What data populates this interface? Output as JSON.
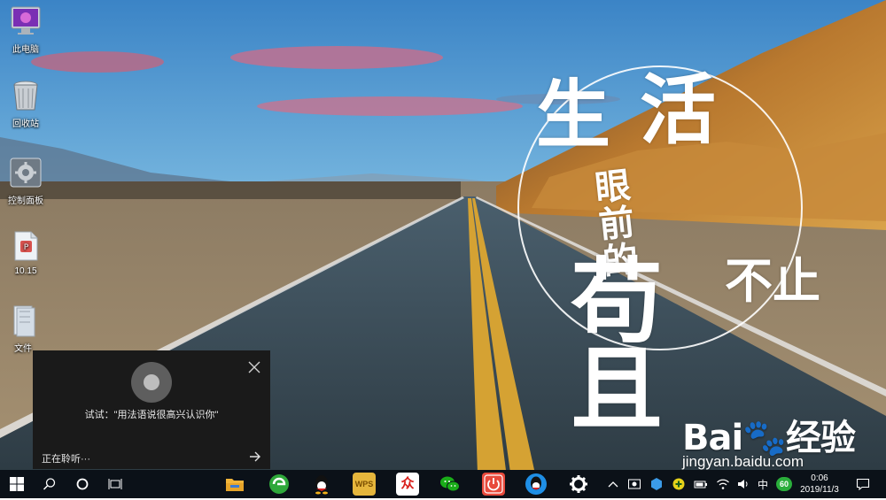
{
  "wallpaper": {
    "calligraphy": {
      "char_1": "生",
      "char_2": "活",
      "line_3": "眼前的",
      "line_4": "不止",
      "line_5": "苟且"
    },
    "watermark": {
      "logo": "Bai🐾经验",
      "url": "jingyan.baidu.com"
    }
  },
  "desktop_icons": [
    {
      "label": "此电脑",
      "icon": "this-pc-icon"
    },
    {
      "label": "回收站",
      "icon": "recycle-bin-icon"
    },
    {
      "label": "控制面板",
      "icon": "control-panel-icon"
    },
    {
      "label": "10.15",
      "icon": "document-icon"
    },
    {
      "label": "文件",
      "icon": "folder-icon"
    }
  ],
  "voice_panel": {
    "hint": "试试：\"用法语说很高兴认识你\"",
    "status": "正在聆听···"
  },
  "taskbar": {
    "pinned": [
      {
        "name": "file-explorer-icon",
        "color": "#f2b53a"
      },
      {
        "name": "browser-icon",
        "color": "#2fa83a"
      },
      {
        "name": "qq-icon",
        "color": "#111111"
      },
      {
        "name": "wps-icon",
        "color": "#e6b63c",
        "text": "WPS"
      },
      {
        "name": "app-zhong-icon",
        "color": "#ffffff",
        "text": "众"
      },
      {
        "name": "wechat-icon",
        "color": "#1aad19"
      },
      {
        "name": "power-app-icon",
        "color": "#e84a3c"
      },
      {
        "name": "qq-blue-icon",
        "color": "#1f8fe6"
      },
      {
        "name": "settings-icon",
        "color": "#ffffff"
      }
    ],
    "tray": {
      "ime": "中",
      "badge": "60",
      "time": "0:06",
      "date": "2019/11/3"
    }
  },
  "colors": {
    "taskbar": "#0b1118",
    "panel": "#1a1a1a"
  }
}
